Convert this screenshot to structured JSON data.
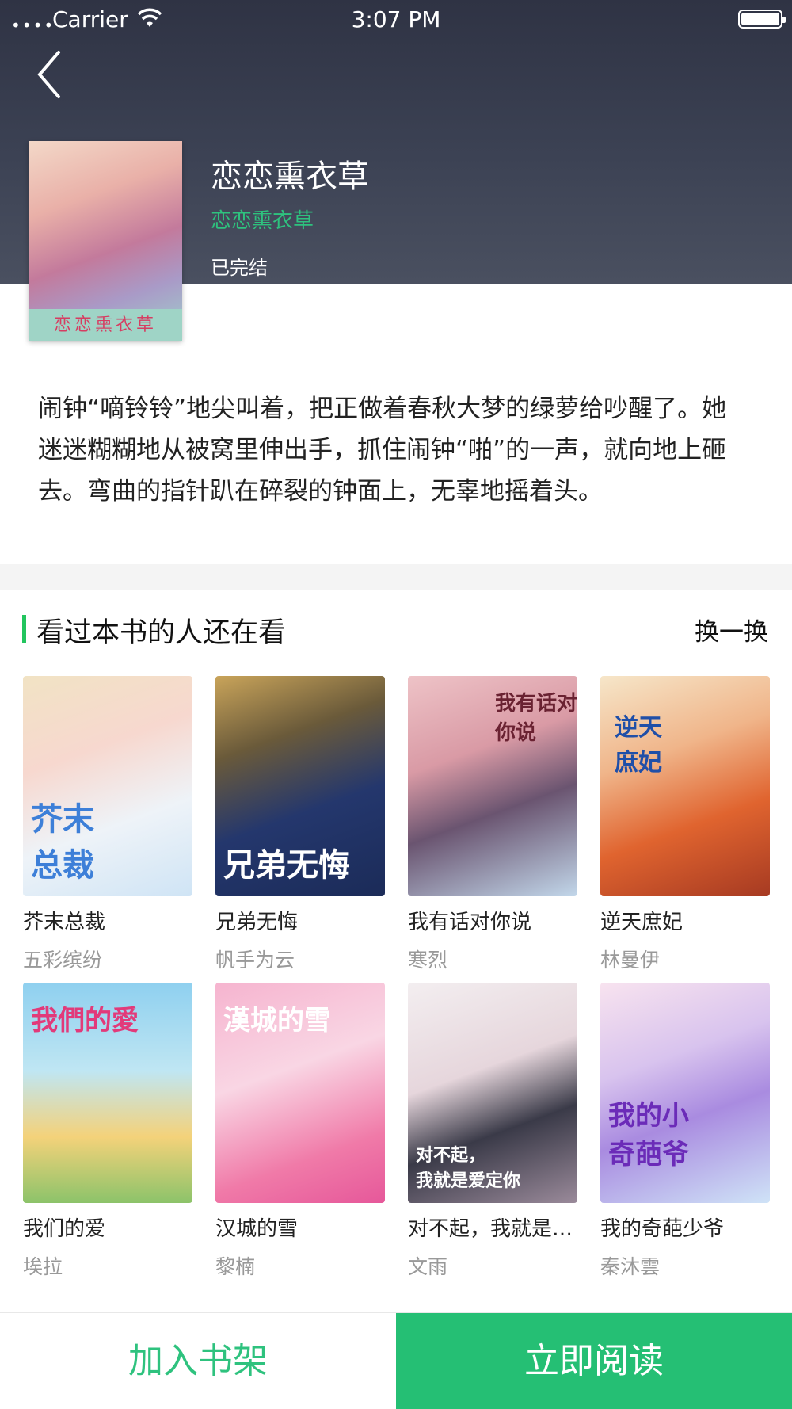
{
  "status_bar": {
    "carrier": "Carrier",
    "time": "3:07 PM"
  },
  "book": {
    "title": "恋恋熏衣草",
    "author": "恋恋熏衣草",
    "status": "已完结",
    "cover_caption": "恋恋熏衣草",
    "description": "闹钟“嘀铃铃”地尖叫着，把正做着春秋大梦的绿萝给吵醒了。她迷迷糊糊地从被窝里伸出手，抓住闹钟“啪”的一声，就向地上砸去。弯曲的指针趴在碎裂的钟面上，无辜地摇着头。"
  },
  "recommend": {
    "title": "看过本书的人还在看",
    "refresh_label": "换一换",
    "accent_color": "#22c55e",
    "books": [
      {
        "name": "芥末总裁",
        "author": "五彩缤纷"
      },
      {
        "name": "兄弟无悔",
        "author": "帆手为云"
      },
      {
        "name": "我有话对你说",
        "author": "寒烈"
      },
      {
        "name": "逆天庶妃",
        "author": "林曼伊"
      },
      {
        "name": "我们的爱",
        "author": "埃拉"
      },
      {
        "name": "汉城的雪",
        "author": "黎楠"
      },
      {
        "name": "对不起，我就是…",
        "author": "文雨"
      },
      {
        "name": "我的奇葩少爷",
        "author": "秦沐雲"
      }
    ]
  },
  "bottom_bar": {
    "add_label": "加入书架",
    "read_label": "立即阅读",
    "accent_color": "#25bf74"
  }
}
